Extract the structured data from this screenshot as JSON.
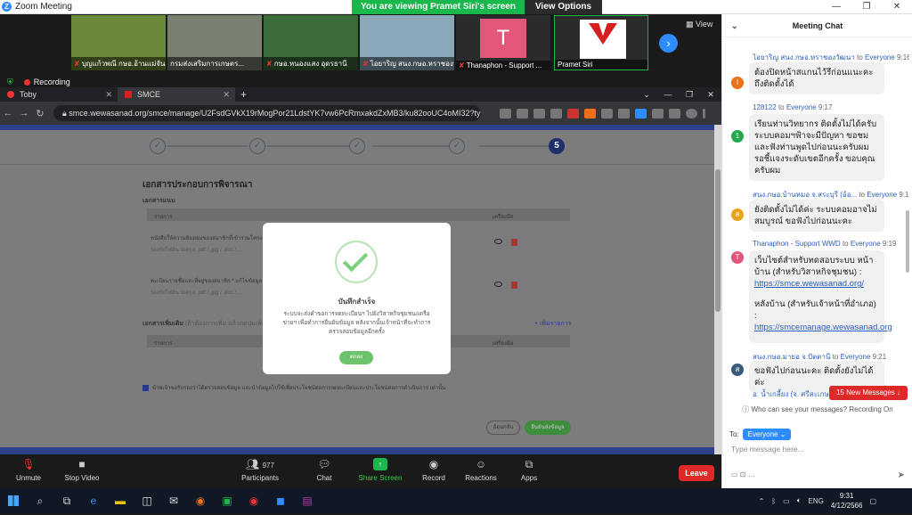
{
  "zoom": {
    "title": "Zoom Meeting",
    "viewing_banner": "You are viewing Pramet Siri's screen",
    "view_options": "View Options",
    "gallery_view_label": "View",
    "participants": [
      {
        "name": "บุญแก้วพณี กษอ.อ้านแม่จัน..."
      },
      {
        "name": "กรมส่งเสริมการเกษตร..."
      },
      {
        "name": "กษอ.หนองแสง อุดรธานี"
      },
      {
        "name": "ไอยาริญ สนง.กษอ.หราชองวัฒนา"
      },
      {
        "name": "Thanaphon - Support ..."
      },
      {
        "name": "Pramet Siri"
      }
    ],
    "avatar_letter": "T",
    "recording_label": "Recording",
    "toolbar": {
      "unmute": "Unmute",
      "stop_video": "Stop Video",
      "participants": "Participants",
      "participants_count": "977",
      "chat": "Chat",
      "share_screen": "Share Screen",
      "record": "Record",
      "reactions": "Reactions",
      "apps": "Apps",
      "leave": "Leave"
    }
  },
  "browser": {
    "tabs": [
      {
        "label": "Toby"
      },
      {
        "label": "SMCE"
      }
    ],
    "url": "smce.wewasanad.org/smce/manage/U2FsdGVkX19rMogPor21LdstYK7vw6PcRmxakdZxMB3/ku82ooUC4oMI32?type=register"
  },
  "page": {
    "steps": [
      "✓",
      "✓",
      "✓",
      "✓",
      "5"
    ],
    "section_title": "เอกสารประกอบการพิจารณา",
    "attachments_title": "เอกสารแนบ",
    "col_list": "รายการ",
    "col_action": "เครื่องมือ",
    "docs": [
      {
        "title": "หนังสือให้ความยินยอมของสมาชิกที่เข้าร่วมโครงการ...",
        "sub": "รองรับไฟล์นามสกุล .pdf / .jpg / .doc / ..."
      },
      {
        "title": "ทะเบียนรายชื่อและที่อยู่ของสมาชิก * แก้ไขข้อมูล",
        "sub": "รองรับไฟล์นามสกุล .pdf / .jpg / .doc / ..."
      }
    ],
    "extra_title": "เอกสารเพิ่มเติม",
    "extra_hint": "(ถ้าต้องการเพิ่ม แล้วกดปุ่มเพิ่มรายการ)",
    "add_more": "+ เพิ่มรายการ",
    "consent_text": "ข้าพเจ้าขอรับรองว่าได้ตรวจสอบข้อมูล และนำข้อมูลไปใช้เพื่อประโยชน์ต่อการจดทะเบียนและประโยชน์ต่อการดำเนินการ เท่านั้น",
    "back_button": "ย้อนกลับ",
    "confirm_button": "ยืนยันส่งข้อมูล"
  },
  "modal": {
    "title": "บันทึกสำเร็จ",
    "body": "ระบบจะส่งคำขอการจดทะเบียนฯ ไปยังวิสาหกิจชุมชน/เครือข่ายฯ เพื่อทำการยืนยันข้อมูล หลังจากนั้นเจ้าหน้าที่จะทำการตรวจสอบข้อมูลอีกครั้ง",
    "ok_button": "ตกลง"
  },
  "chat": {
    "title": "Meeting Chat",
    "messages": [
      {
        "sender": "ไอยาริญ สนง.กษอ.หราชองวัฒนา",
        "to": "Everyone",
        "time": "9:16",
        "avatar": "I",
        "color": "#e8711a",
        "text": "ต้องปิดหน้าสแกนไว้รึก่อนแนะคะ ถึงติดตั้งได้",
        "link": "",
        "link2": "",
        "text2": ""
      },
      {
        "sender": "128122",
        "to": "Everyone",
        "time": "9:17",
        "avatar": "1",
        "color": "#23a84b",
        "text": "เรียนท่านวิทยากร ติดตั้งไม่ได้ครับ ระบบคอมฯฟ้าจะมีปัญหา ขอชมและฟังท่านพูดไปก่อนนะครับผม รอชี้แจงระดับเขตอีกครั้ง ขอบคุณครับผม",
        "link": "",
        "link2": "",
        "text2": ""
      },
      {
        "sender": "สนง.กษอ.บ้านหมอ จ.สระบุรี (อ้อ...",
        "to": "Everyone",
        "time": "9:19",
        "avatar": "ส",
        "color": "#e8a31a",
        "text": "ยังติดตั้งไม่ได้ค่ะ ระบบคอมอาจไม่สมบูรณ์ ขอฟังไปก่อนนะคะ",
        "link": "",
        "link2": "",
        "text2": ""
      },
      {
        "sender": "Thanaphon - Support WWD",
        "to": "Everyone",
        "time": "9:19",
        "avatar": "T",
        "color": "#e25679",
        "text": "เว็บไซต์สำหรับทดสอบระบบ หน้าบ้าน (สำหรับวิสาหกิจชุมชน) :",
        "link": "https://smce.wewasanad.org/",
        "text2": "หลังบ้าน (สำหรับเจ้าหน้าที่อำเภอ) :",
        "link2": "https://smcemanage.wewasanad.org"
      },
      {
        "sender": "สนง.กษอ.มายอ จ.ปัตตานี",
        "to": "Everyone",
        "time": "9:21",
        "avatar": "ส",
        "color": "#3a5a7a",
        "text": "ขอฟังไปก่อนนะคะ ติดตั้งยังไม่ได้ค่ะ",
        "link": "",
        "link2": "",
        "text2": ""
      },
      {
        "sender": "อ. น้ำเกลี้ยง (จ. ศรีสะเกษ)",
        "to": "",
        "time": "",
        "avatar": "",
        "color": "#3a5a7a",
        "text": "",
        "link": "",
        "link2": "",
        "text2": ""
      }
    ],
    "new_messages": "15 New Messages",
    "who_can_see": "Who can see your messages? Recording On",
    "to_label": "To:",
    "to_value": "Everyone",
    "input_placeholder": "Type message here..."
  },
  "taskbar": {
    "lang": "ENG",
    "time": "9:31",
    "date": "4/12/2566"
  }
}
